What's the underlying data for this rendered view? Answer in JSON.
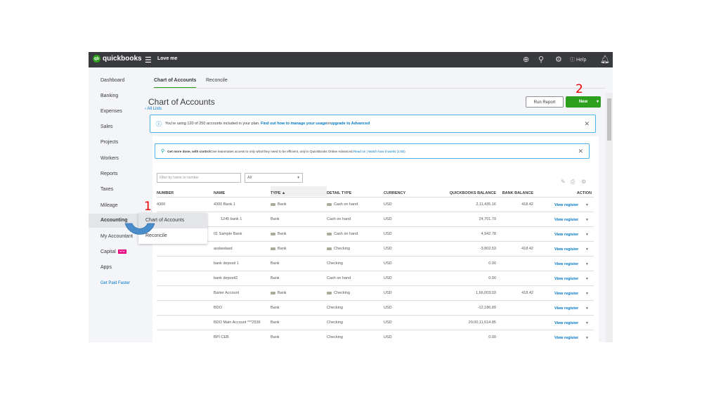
{
  "topbar": {
    "logo": "quickbooks",
    "company": "Love me",
    "help": "Help"
  },
  "sidebar": {
    "items": [
      "Dashboard",
      "Banking",
      "Expenses",
      "Sales",
      "Projects",
      "Workers",
      "Reports",
      "Taxes",
      "Mileage",
      "Accounting",
      "My Accountant",
      "Capital",
      "Apps"
    ],
    "new_badge": "NEW",
    "get_paid": "Get Paid Faster"
  },
  "menu": {
    "items": [
      "Chart of Accounts",
      "Reconcile"
    ]
  },
  "tabs": [
    "Chart of Accounts",
    "Reconcile"
  ],
  "page": {
    "title": "Chart of Accounts",
    "back": "All Lists",
    "run_report": "Run Report",
    "new": "New"
  },
  "banner1": {
    "text": "You're using 120 of 250 accounts included in your plan. ",
    "link1": "Find out how to manage your usage",
    "or": " or ",
    "link2": "upgrade to Advanced"
  },
  "banner2": {
    "bold": "Get more done, with control ",
    "text": "Give teammates access to only what they need to be efficient, only in QuickBooks Online Advanced. ",
    "link": "Read on | Watch how it works (1:55)"
  },
  "filter": {
    "placeholder": "Filter by name or number",
    "select": "All"
  },
  "table": {
    "headers": [
      "NUMBER",
      "NAME",
      "TYPE ▲",
      "DETAIL TYPE",
      "CURRENCY",
      "QUICKBOOKS BALANCE",
      "BANK BALANCE",
      "ACTION"
    ],
    "action_label": "View register",
    "rows": [
      {
        "number": "4300",
        "name": "4300 Bank.1",
        "type": "Bank",
        "detail": "Cash on hand",
        "currency": "USD",
        "qb": "2,11,435.16",
        "bank": "418.42",
        "icon": true
      },
      {
        "number": "1245",
        "name": "1245 bank 1",
        "type": "Bank",
        "detail": "Cash on hand",
        "currency": "USD",
        "qb": "24,701.70",
        "bank": "",
        "icon": false
      },
      {
        "number": "",
        "name": "01 Sample Bank",
        "type": "Bank",
        "detail": "Cash on hand",
        "currency": "USD",
        "qb": "4,942.78",
        "bank": "",
        "icon": true
      },
      {
        "number": "",
        "name": "asdasdasd",
        "type": "Bank",
        "detail": "Checking",
        "currency": "USD",
        "qb": "-3,802.53",
        "bank": "418.42",
        "icon": true
      },
      {
        "number": "",
        "name": "bank deposit 1",
        "type": "Bank",
        "detail": "Checking",
        "currency": "USD",
        "qb": "0.00",
        "bank": "",
        "icon": false
      },
      {
        "number": "",
        "name": "bank deposit2",
        "type": "Bank",
        "detail": "Cash on hand",
        "currency": "USD",
        "qb": "0.00",
        "bank": "",
        "icon": false
      },
      {
        "number": "",
        "name": "Barter Account",
        "type": "Bank",
        "detail": "Checking",
        "currency": "USD",
        "qb": "1,66,003.03",
        "bank": "418.42",
        "icon": true
      },
      {
        "number": "",
        "name": "BDO",
        "type": "Bank",
        "detail": "Checking",
        "currency": "USD",
        "qb": "-12,186.89",
        "bank": "",
        "icon": false
      },
      {
        "number": "",
        "name": "BDO Main Account ***2536",
        "type": "Bank",
        "detail": "Checking",
        "currency": "USD",
        "qb": "20,00,11,614.85",
        "bank": "",
        "icon": false
      },
      {
        "number": "",
        "name": "BPI CEB",
        "type": "Bank",
        "detail": "Checking",
        "currency": "USD",
        "qb": "0.00",
        "bank": "",
        "icon": false
      }
    ]
  },
  "annotations": {
    "step1": "1",
    "step2": "2"
  },
  "colors": {
    "brand": "#2ca01c",
    "link": "#0077c5",
    "annotation": "#e00000",
    "arc": "#4a8cc9"
  }
}
